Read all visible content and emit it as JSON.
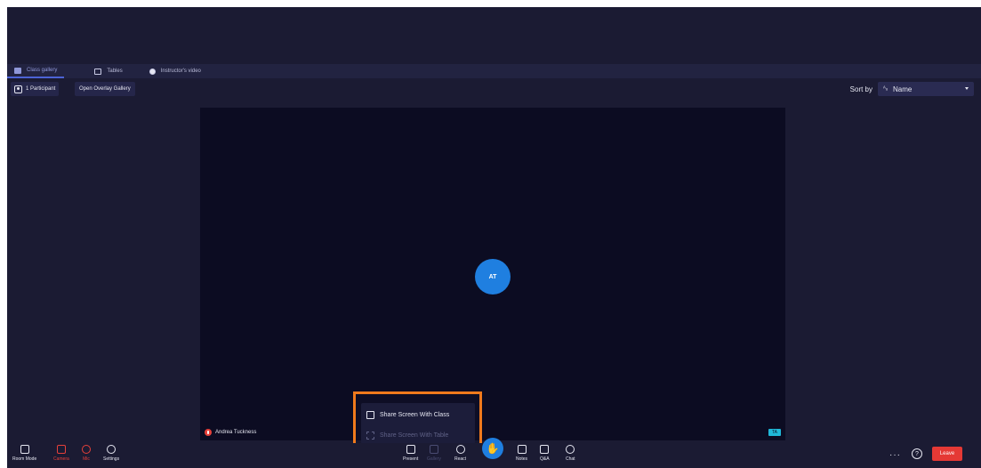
{
  "tabs": [
    {
      "label": "Class gallery",
      "icon": "gallery-icon",
      "active": true
    },
    {
      "label": "Tables",
      "icon": "tables-icon",
      "active": false
    },
    {
      "label": "Instructor's video",
      "icon": "video-icon",
      "active": false
    }
  ],
  "toolbar": {
    "participants_label": "1 Participant",
    "overlay_label": "Open Overlay Gallery",
    "sort_label": "Sort by",
    "sort_value": "Name"
  },
  "stage": {
    "avatar_initials": "AT",
    "participant_name": "Andrea Tuckness",
    "host_badge": "TA"
  },
  "share_menu": {
    "item_class": "Share Screen With Class",
    "item_table": "Share Screen With Table"
  },
  "controls": {
    "room_mode": "Room Mode",
    "camera": "Camera",
    "mic": "Mic",
    "settings": "Settings",
    "present": "Present",
    "gallery": "Gallery",
    "react": "React",
    "notes": "Notes",
    "qa": "Q&A",
    "chat": "Chat",
    "leave": "Leave"
  },
  "colors": {
    "background": "#1b1b33",
    "stage": "#0c0c22",
    "accent": "#1f7fe0",
    "danger": "#e53935",
    "highlight_frame": "#f07a1c"
  }
}
